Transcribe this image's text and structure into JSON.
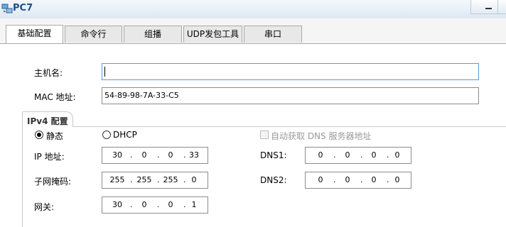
{
  "window": {
    "title": "PC7"
  },
  "tabs": [
    {
      "label": "基础配置"
    },
    {
      "label": "命令行"
    },
    {
      "label": "组播"
    },
    {
      "label": "UDP发包工具"
    },
    {
      "label": "串口"
    }
  ],
  "basic": {
    "hostname_label": "主机名:",
    "hostname_value": "",
    "mac_label": "MAC 地址:",
    "mac_value": "54-89-98-7A-33-C5"
  },
  "ipv4": {
    "group_title": "IPv4 配置",
    "static_label": "静态",
    "dhcp_label": "DHCP",
    "mode": "static",
    "auto_dns_label": "自动获取 DNS 服务器地址",
    "ip_label": "IP 地址:",
    "ip": [
      "30",
      "0",
      "0",
      "33"
    ],
    "mask_label": "子网掩码:",
    "mask": [
      "255",
      "255",
      "255",
      "0"
    ],
    "gateway_label": "网关:",
    "gateway": [
      "30",
      "0",
      "0",
      "1"
    ],
    "dns1_label": "DNS1:",
    "dns1": [
      "0",
      "0",
      "0",
      "0"
    ],
    "dns2_label": "DNS2:",
    "dns2": [
      "0",
      "0",
      "0",
      "0"
    ]
  }
}
